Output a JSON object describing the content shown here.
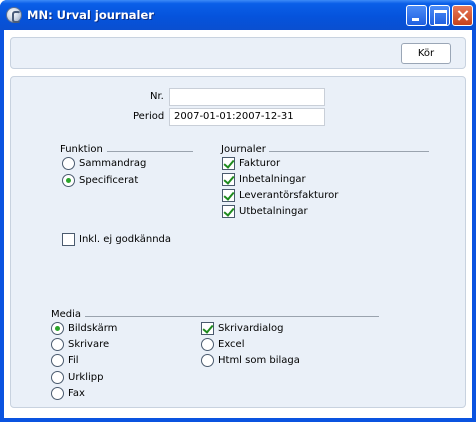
{
  "window": {
    "title": "MN: Urval journaler"
  },
  "toolbar": {
    "run_label": "Kör"
  },
  "form": {
    "nr_label": "Nr.",
    "nr_value": "",
    "period_label": "Period",
    "period_value": "2007-01-01:2007-12-31"
  },
  "funktion": {
    "title": "Funktion",
    "options": [
      {
        "label": "Sammandrag",
        "selected": false
      },
      {
        "label": "Specificerat",
        "selected": true
      }
    ]
  },
  "journaler": {
    "title": "Journaler",
    "options": [
      {
        "label": "Fakturor",
        "checked": true
      },
      {
        "label": "Inbetalningar",
        "checked": true
      },
      {
        "label": "Leverantörsfakturor",
        "checked": true
      },
      {
        "label": "Utbetalningar",
        "checked": true
      }
    ]
  },
  "inkl": {
    "label": "Inkl. ej godkännda",
    "checked": false
  },
  "media": {
    "title": "Media",
    "options": [
      {
        "label": "Bildskärm",
        "selected": true
      },
      {
        "label": "Skrivare",
        "selected": false
      },
      {
        "label": "Fil",
        "selected": false
      },
      {
        "label": "Urklipp",
        "selected": false
      },
      {
        "label": "Fax",
        "selected": false
      }
    ],
    "skrivardialog": {
      "label": "Skrivardialog",
      "checked": true
    },
    "extra": [
      {
        "label": "Excel",
        "selected": false
      },
      {
        "label": "Html som bilaga",
        "selected": false
      }
    ]
  }
}
